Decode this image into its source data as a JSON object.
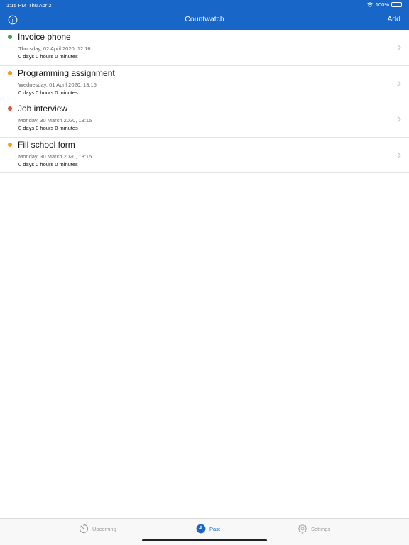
{
  "status_bar": {
    "time": "1:15 PM",
    "date": "Thu Apr 2",
    "battery": "100%"
  },
  "navbar": {
    "title": "Countwatch",
    "add_label": "Add",
    "info_icon": "info-icon"
  },
  "colors": {
    "accent": "#1766c8",
    "green": "#3aa655",
    "orange": "#f39c12",
    "red": "#e74c3c"
  },
  "items": [
    {
      "title": "Invoice phone",
      "date": "Thursday, 02 April 2020, 12:16",
      "countdown": "0 days 0 hours 0 minutes",
      "color": "#3aa655"
    },
    {
      "title": "Programming assignment",
      "date": "Wednesday, 01 April 2020, 13:15",
      "countdown": "0 days 0 hours 0 minutes",
      "color": "#f39c12"
    },
    {
      "title": "Job interview",
      "date": "Monday, 30 March 2020, 13:15",
      "countdown": "0 days 0 hours 0 minutes",
      "color": "#e74c3c"
    },
    {
      "title": "Fill school form",
      "date": "Monday, 30 March 2020, 13:15",
      "countdown": "0 days 0 hours 0 minutes",
      "color": "#f39c12"
    }
  ],
  "tabs": [
    {
      "label": "Upcoming",
      "icon": "timer-icon",
      "active": false
    },
    {
      "label": "Past",
      "icon": "clock-icon",
      "active": true
    },
    {
      "label": "Settings",
      "icon": "gear-icon",
      "active": false
    }
  ]
}
